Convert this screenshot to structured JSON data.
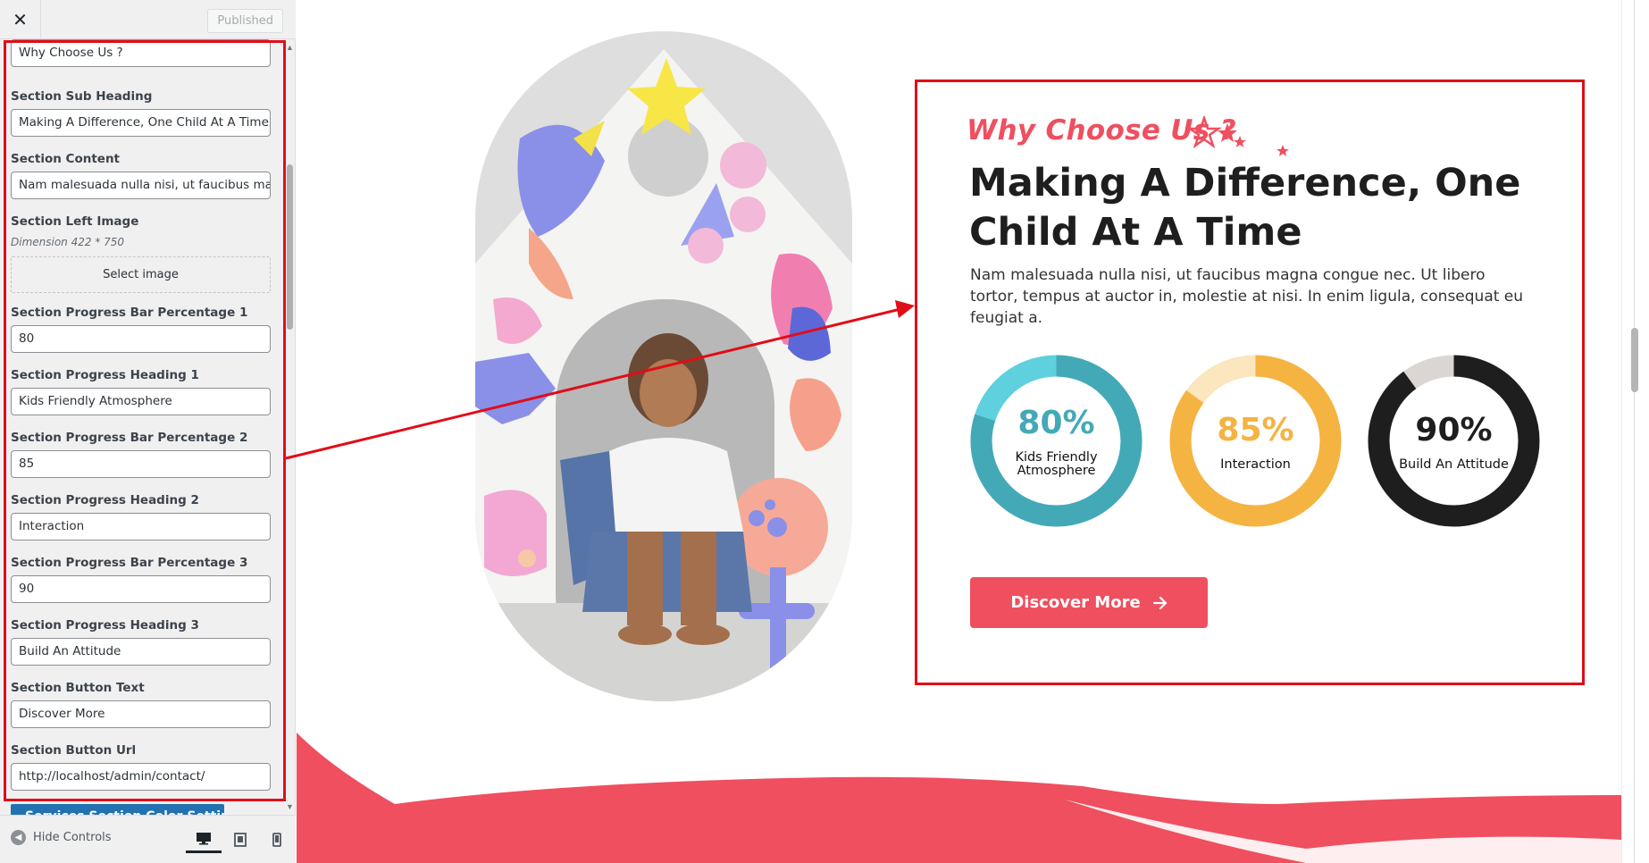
{
  "sidebar": {
    "close_glyph": "✕",
    "published_label": "Published",
    "fields": {
      "section_heading_value": "Why Choose Us ?",
      "sub_heading_label": "Section Sub Heading",
      "sub_heading_value": "Making A Difference, One Child At A Time",
      "content_label": "Section Content",
      "content_value": "Nam malesuada nulla nisi, ut faucibus magna congue nec. Ut libero tortor,",
      "left_image_label": "Section Left Image",
      "left_image_desc": "Dimension 422 * 750",
      "select_image_label": "Select image",
      "pb1_label": "Section Progress Bar Percentage 1",
      "pb1_value": "80",
      "ph1_label": "Section Progress Heading 1",
      "ph1_value": "Kids Friendly Atmosphere",
      "pb2_label": "Section Progress Bar Percentage 2",
      "pb2_value": "85",
      "ph2_label": "Section Progress Heading 2",
      "ph2_value": "Interaction",
      "pb3_label": "Section Progress Bar Percentage 3",
      "pb3_value": "90",
      "ph3_label": "Section Progress Heading 3",
      "ph3_value": "Build An Attitude",
      "btn_text_label": "Section Button Text",
      "btn_text_value": "Discover More",
      "btn_url_label": "Section Button Url",
      "btn_url_value": "http://localhost/admin/contact/"
    },
    "next_section_label": "Services Section Color Settings",
    "footer": {
      "hide_controls_label": "Hide Controls"
    }
  },
  "preview": {
    "tagline": "Why Choose Us ?",
    "heading": "Making A Difference, One Child At A Time",
    "body": "Nam malesuada nulla nisi, ut faucibus magna congue nec. Ut libero tortor, tempus at auctor in, molestie at nisi. In enim ligula, consequat eu feugiat a.",
    "progress": [
      {
        "percent_label": "80%",
        "value": 80,
        "heading": "Kids Friendly Atmosphere",
        "color": "#44a9b7",
        "track": "#5fd0dd",
        "text_color": "#44a9b7"
      },
      {
        "percent_label": "85%",
        "value": 85,
        "heading": "Interaction",
        "color": "#f5b342",
        "track": "#fbe6bd",
        "text_color": "#f5b342"
      },
      {
        "percent_label": "90%",
        "value": 90,
        "heading": "Build An Attitude",
        "color": "#1e1e1e",
        "track": "#dcd6d3",
        "text_color": "#1e1e1e"
      }
    ],
    "button_label": "Discover More",
    "colors": {
      "accent": "#ef4f5f",
      "highlight_border": "#e10d18",
      "wp_blue": "#2271b1"
    }
  }
}
